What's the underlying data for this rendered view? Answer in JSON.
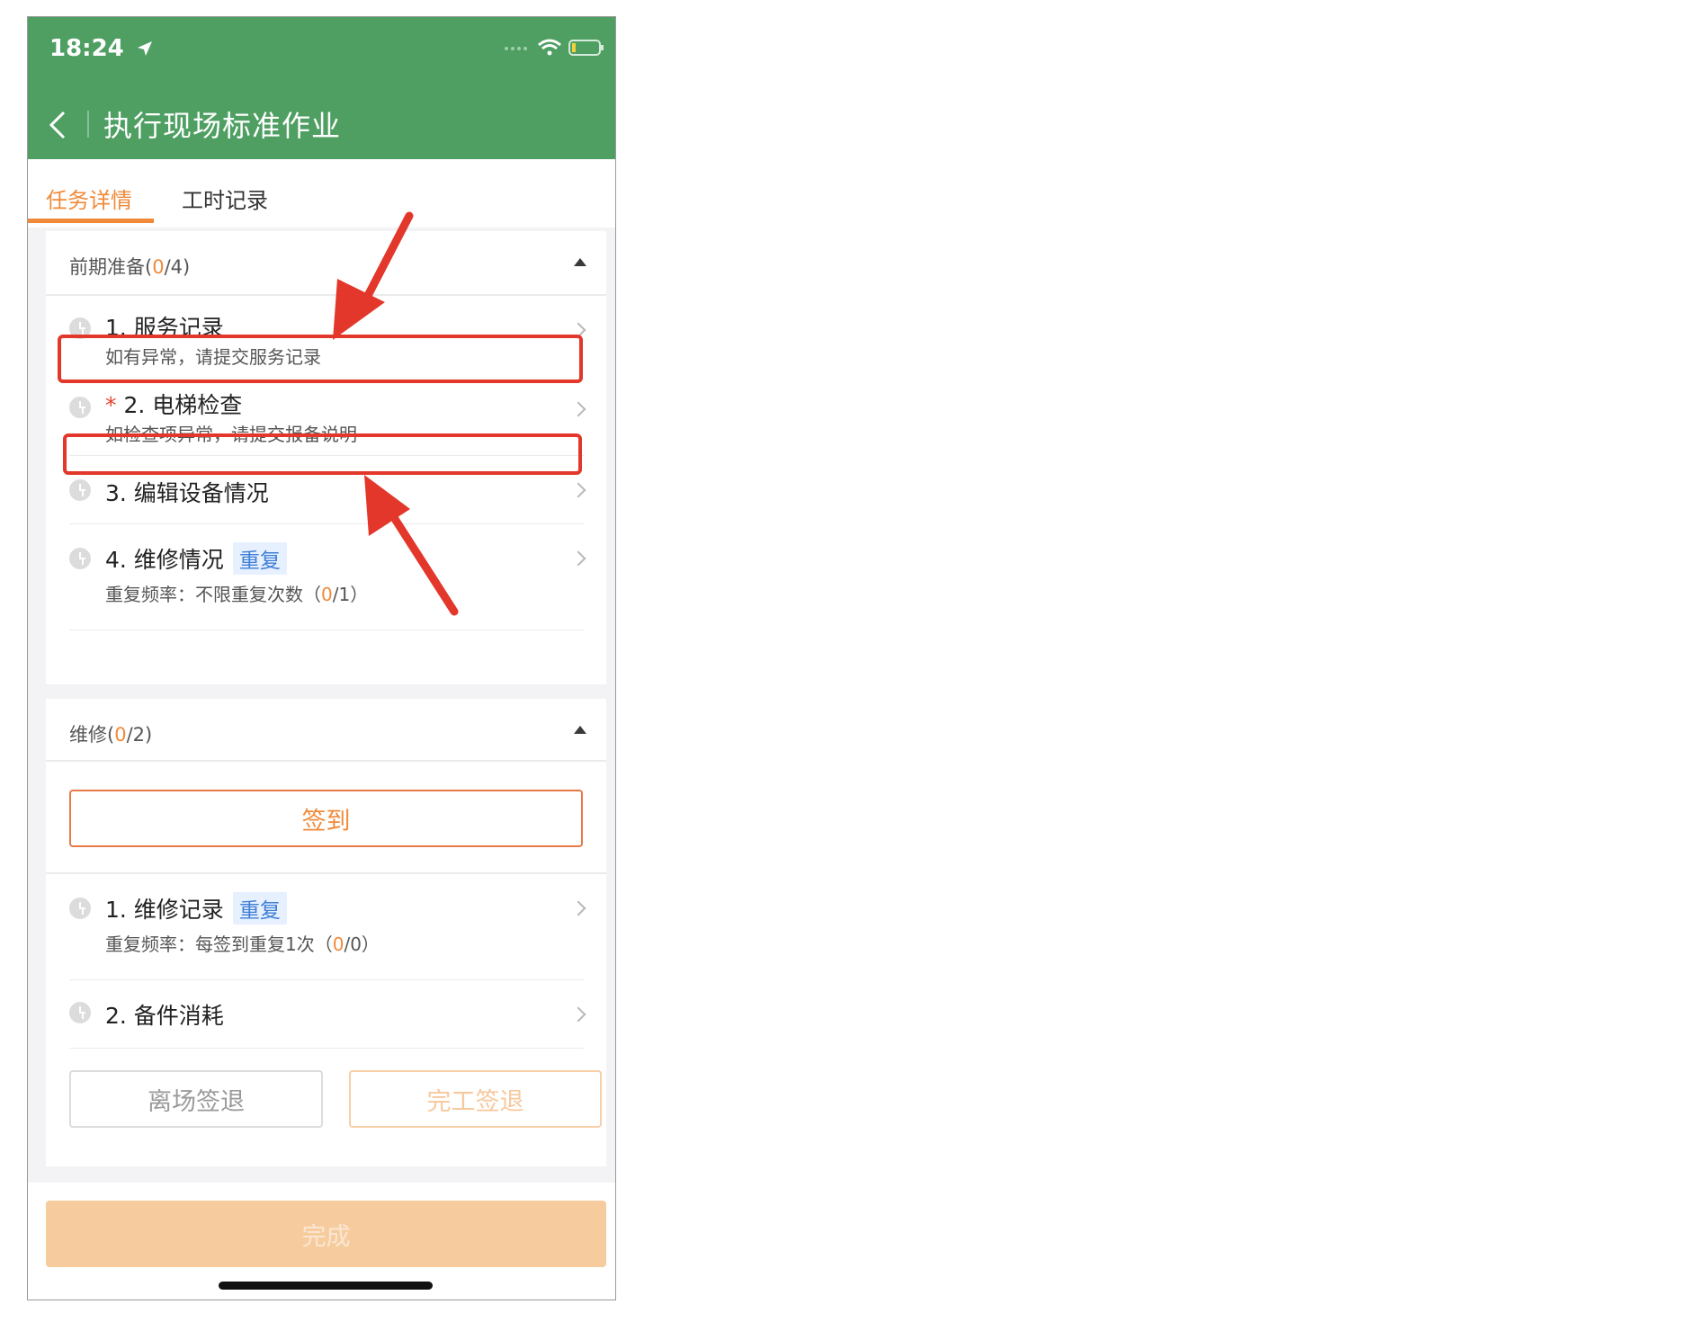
{
  "status_bar": {
    "time": "18:24"
  },
  "nav": {
    "title": "执行现场标准作业"
  },
  "tabs": [
    {
      "label": "任务详情",
      "active": true
    },
    {
      "label": "工时记录",
      "active": false
    }
  ],
  "section_prep": {
    "title": "前期准备",
    "progress_done": "0",
    "progress_total": "/4)",
    "progress_open": "(",
    "items": [
      {
        "title": "1. 服务记录",
        "subtitle": "如有异常，请提交服务记录"
      },
      {
        "title": "2. 电梯检查",
        "required_mark": "*",
        "subtitle": "如检查项异常，请提交报备说明"
      },
      {
        "title": "3. 编辑设备情况"
      },
      {
        "title": "4. 维修情况",
        "badge": "重复",
        "subtitle_prefix": "重复频率：不限重复次数（",
        "subtitle_done": "0",
        "subtitle_suffix": "/1）"
      }
    ]
  },
  "section_repair": {
    "title": "维修",
    "progress_open": "(",
    "progress_done": "0",
    "progress_total": "/2)",
    "signin_label": "签到",
    "items": [
      {
        "title": "1. 维修记录",
        "badge": "重复",
        "subtitle_prefix": "重复频率：每签到重复1次（",
        "subtitle_done": "0",
        "subtitle_suffix": "/0）"
      },
      {
        "title": "2. 备件消耗"
      }
    ],
    "leave_label": "离场签退",
    "finish_signout_label": "完工签退"
  },
  "footer": {
    "complete_label": "完成"
  },
  "colors": {
    "header_green": "#4f9f63",
    "accent_orange": "#f08a3a",
    "annotation_red": "#e2372a",
    "badge_blue": "#3f7fd6"
  }
}
